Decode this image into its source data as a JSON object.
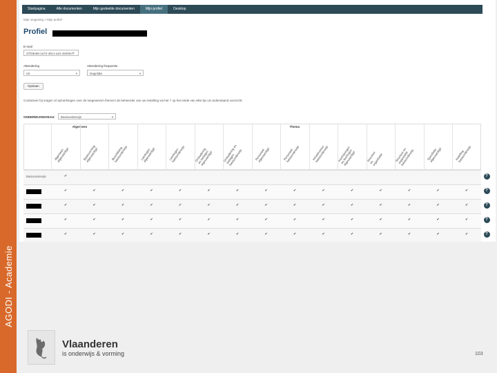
{
  "side_label": "AGODI - Academie",
  "nav": {
    "items": [
      "Startpagina",
      "Alle documenten",
      "Mijn gedeelde documenten",
      "Mijn profiel",
      "Desktop"
    ],
    "active_index": 3,
    "accent": "#2d4a57"
  },
  "breadcrumb": "Mijn omgeving  >  Mijn profiel",
  "page_title": "Profiel",
  "email": {
    "label": "E-mail",
    "value": "37f2de68-1a72-48c1-a31-3e5f4e7f"
  },
  "attendering": {
    "label": "Attendering",
    "value": "Uit"
  },
  "frequentie": {
    "label": "Attendering frequentie",
    "value": "Dagelijks"
  },
  "save_label": "Opslaan",
  "info_text": "Contacteer bij vragen of opmerkingen over de toegewezen thema's de beheerder van uw instelling via het ? op het einde van elke lijn uit onderstaand overzicht.",
  "onderwijsniveau": {
    "label": "ONDERWIJSNIVEAU:",
    "value": "Basisonderwijs"
  },
  "table": {
    "group_headers": [
      "Algemeen",
      "Thema"
    ],
    "columns": [
      "Algemeen\nafgevaardigd",
      "Basisvorming\nafgevaardigd",
      "Beschikking\nbasisonderwijs",
      "Leerlingen\nafgevaardigd",
      "Leerlingen\nbasisonderwijs",
      "Omkadering\nen toelagen\nafgevaardigd",
      "Omkadering en\ntoelagen\nbasisonderwijs",
      "Personeel\nafgevaardigd",
      "Personeel\nbasisonderwijs",
      "Infrastructuur\nbasisonderwijs",
      "Inschrijvingen\nen leerlingen\nafgevaardigd",
      "Structuur\nen\norganisatie",
      "Structuur en\norganisatie\nbasisonderwijs",
      "Specifieke\nafgevaardigd",
      "Instelling\nbasisonderwijs"
    ],
    "rows": [
      {
        "label": "Basisonderwijs",
        "checks": [
          true,
          false,
          false,
          false,
          false,
          false,
          false,
          false,
          false,
          false,
          false,
          false,
          false,
          false,
          false
        ]
      },
      {
        "label": "",
        "checks": [
          true,
          true,
          true,
          true,
          true,
          true,
          true,
          true,
          true,
          true,
          true,
          true,
          true,
          true,
          true
        ]
      },
      {
        "label": "",
        "checks": [
          true,
          true,
          true,
          true,
          true,
          true,
          true,
          true,
          true,
          true,
          true,
          true,
          true,
          true,
          true
        ]
      },
      {
        "label": "",
        "checks": [
          true,
          true,
          true,
          true,
          true,
          true,
          true,
          true,
          true,
          true,
          true,
          true,
          true,
          true,
          true
        ]
      },
      {
        "label": "",
        "checks": [
          true,
          true,
          true,
          true,
          true,
          true,
          true,
          true,
          true,
          true,
          true,
          true,
          true,
          true,
          true
        ]
      }
    ],
    "check_glyph": "✔",
    "help_glyph": "?"
  },
  "brand": {
    "name": "Vlaanderen",
    "subtitle": "is onderwijs & vorming"
  },
  "page_number": "103"
}
